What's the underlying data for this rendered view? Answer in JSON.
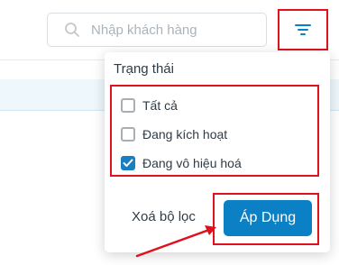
{
  "search": {
    "placeholder": "Nhập khách hàng",
    "icon": "search-icon"
  },
  "filter_button": {
    "icon": "filter-icon"
  },
  "filter_panel": {
    "title": "Trạng thái",
    "options": [
      {
        "label": "Tất cả",
        "checked": false
      },
      {
        "label": "Đang kích hoạt",
        "checked": false
      },
      {
        "label": "Đang vô hiệu hoá",
        "checked": true
      }
    ],
    "clear_label": "Xoá bộ lọc",
    "apply_label": "Áp Dụng"
  },
  "colors": {
    "accent": "#0b80c5",
    "highlight": "#e0101c"
  }
}
